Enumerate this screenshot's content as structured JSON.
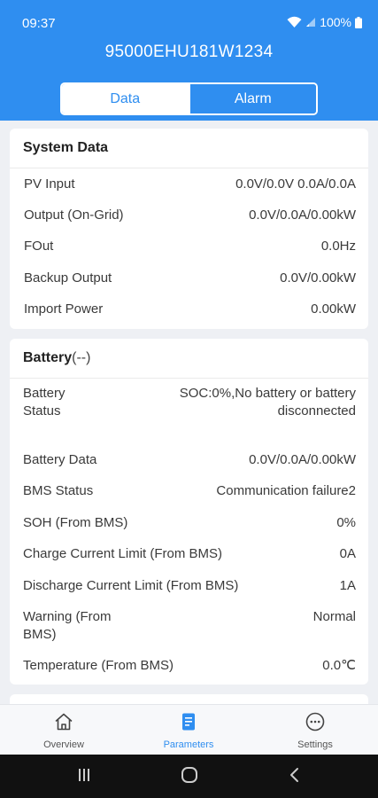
{
  "status_bar": {
    "time": "09:37",
    "battery": "100%"
  },
  "device_serial": "95000EHU181W1234",
  "tabs": {
    "data": "Data",
    "alarm": "Alarm"
  },
  "system_data": {
    "title": "System Data",
    "rows": [
      {
        "label": "PV Input",
        "value": "0.0V/0.0V 0.0A/0.0A"
      },
      {
        "label": "Output (On-Grid)",
        "value": "0.0V/0.0A/0.00kW"
      },
      {
        "label": "FOut",
        "value": "0.0Hz"
      },
      {
        "label": "Backup Output",
        "value": "0.0V/0.00kW"
      },
      {
        "label": "Import Power",
        "value": "0.00kW"
      }
    ]
  },
  "battery": {
    "title": "Battery",
    "subtitle": "(--)",
    "rows": [
      {
        "label_line1": "Battery",
        "label_line2": "Status",
        "value_line1": "SOC:0%,No battery or battery",
        "value_line2": "disconnected"
      },
      {
        "label": "Battery Data",
        "value": "0.0V/0.0A/0.00kW"
      },
      {
        "label": "BMS Status",
        "value": "Communication failure2"
      },
      {
        "label": "SOH (From BMS)",
        "value": "0%"
      },
      {
        "label": "Charge Current Limit (From BMS)",
        "value": "0A"
      },
      {
        "label": "Discharge Current Limit (From BMS)",
        "value": "1A"
      },
      {
        "label_line1": "Warning (From",
        "label_line2": "BMS)",
        "value": "Normal"
      },
      {
        "label": "Temperature (From BMS)",
        "value": "0.0℃"
      }
    ]
  },
  "bottom_nav": [
    {
      "label": "Overview",
      "icon": "home-icon"
    },
    {
      "label": "Parameters",
      "icon": "document-icon"
    },
    {
      "label": "Settings",
      "icon": "more-icon"
    }
  ],
  "colors": {
    "primary": "#2f8ef0",
    "background": "#eef0f4",
    "card": "#ffffff"
  }
}
